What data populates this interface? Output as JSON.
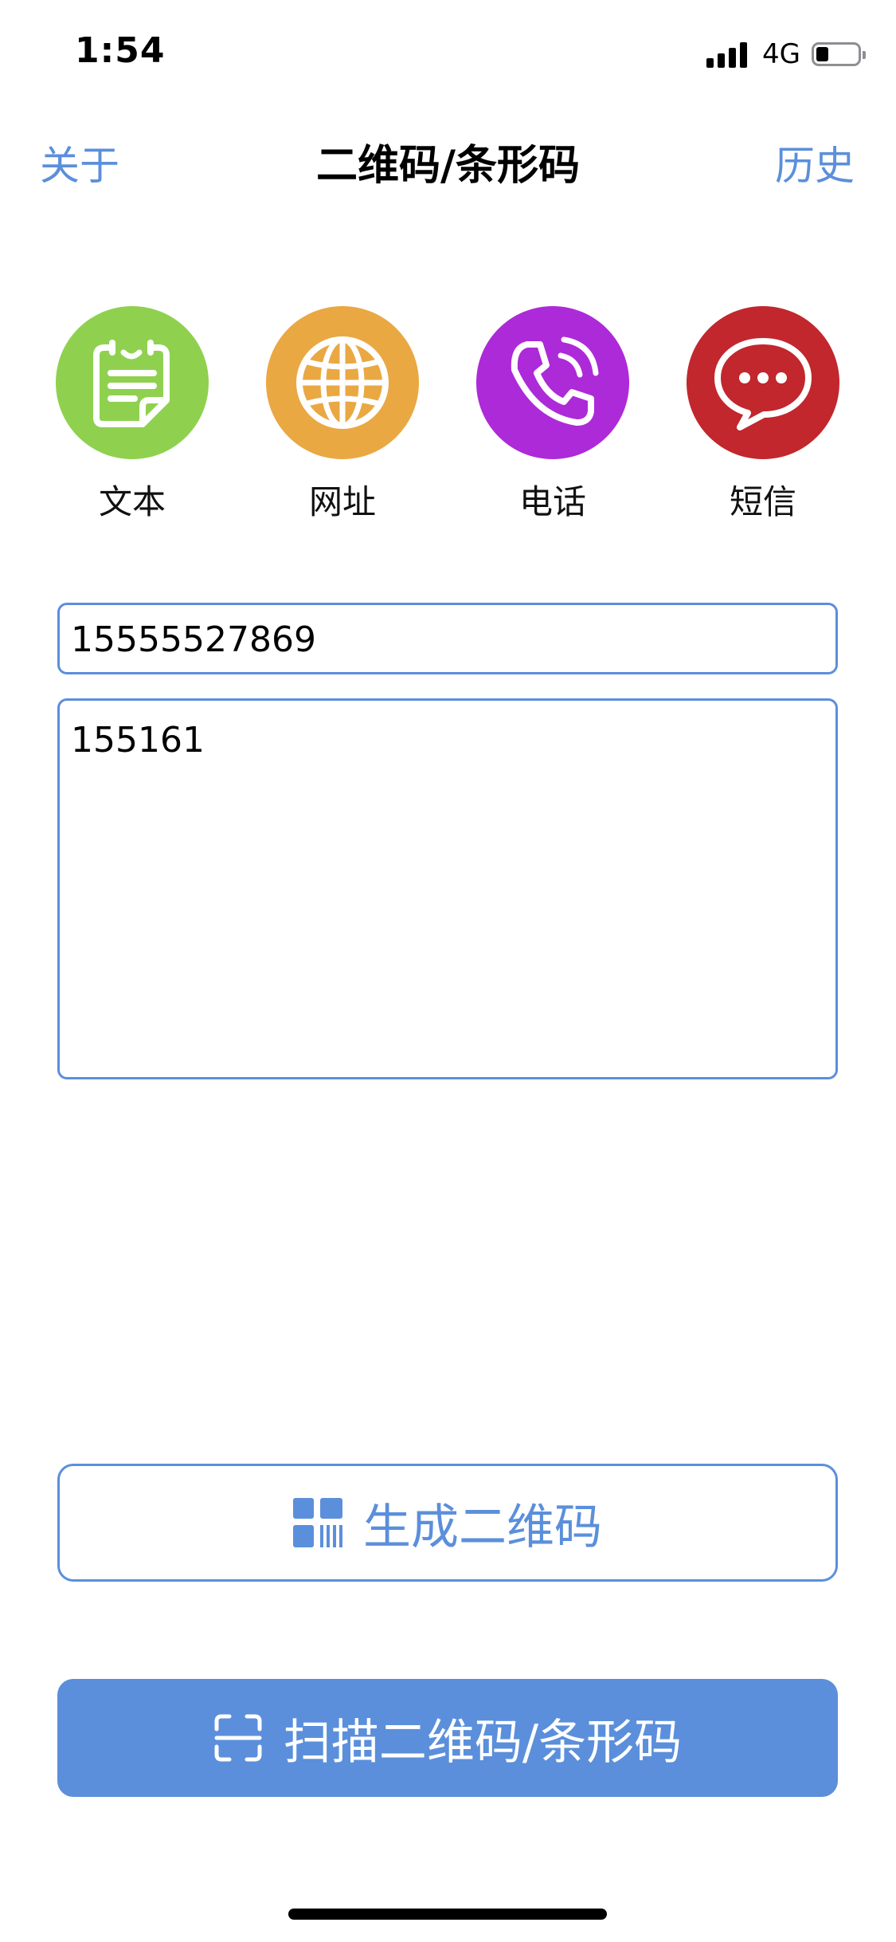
{
  "status_bar": {
    "time": "1:54",
    "network": "4G",
    "battery_level": 0.3
  },
  "nav": {
    "left": "关于",
    "title": "二维码/条形码",
    "right": "历史"
  },
  "categories": [
    {
      "label": "文本",
      "color": "#8fd14f",
      "icon": "document-icon"
    },
    {
      "label": "网址",
      "color": "#eaa843",
      "icon": "globe-icon"
    },
    {
      "label": "电话",
      "color": "#ad2ad8",
      "icon": "phone-icon"
    },
    {
      "label": "短信",
      "color": "#c1272d",
      "icon": "chat-bubble-icon"
    }
  ],
  "form": {
    "phone_value": "15555527869",
    "message_value": "155161"
  },
  "buttons": {
    "generate_label": "生成二维码",
    "scan_label": "扫描二维码/条形码"
  },
  "colors": {
    "accent": "#5b8fdb"
  }
}
